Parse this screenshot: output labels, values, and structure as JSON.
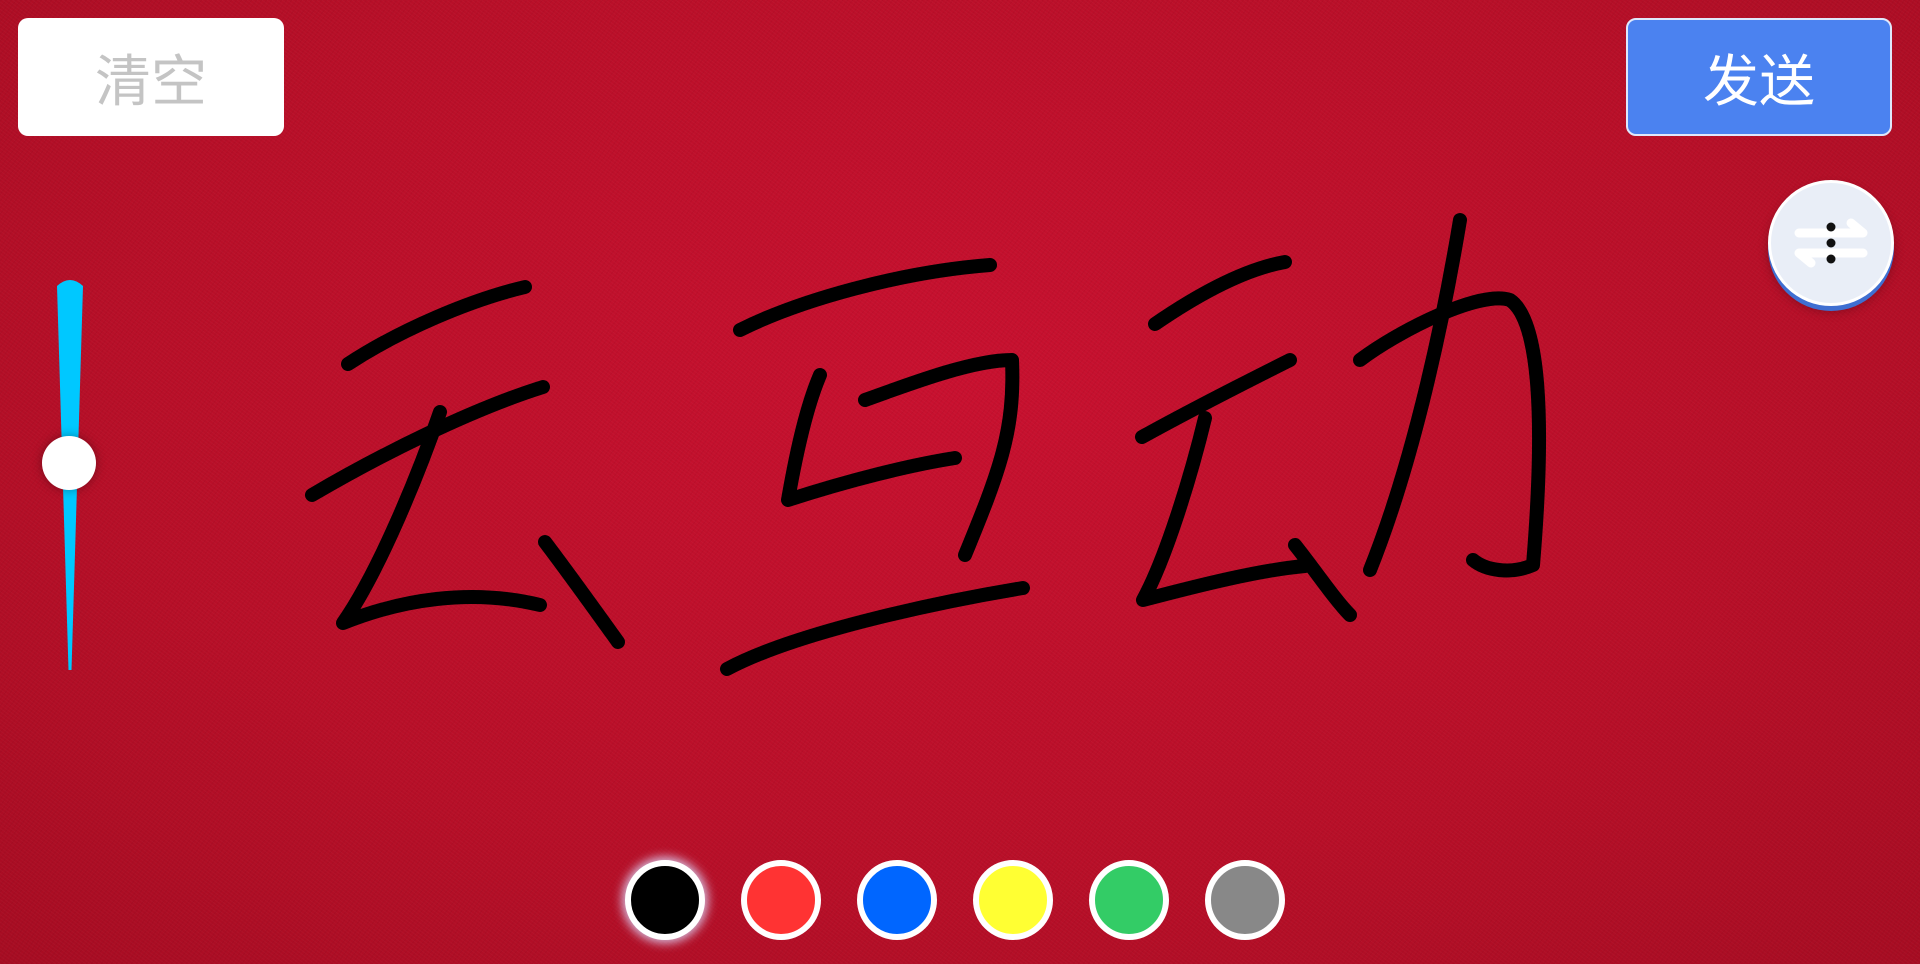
{
  "toolbar": {
    "clear_label": "清空",
    "send_label": "发送"
  },
  "menu_button": {
    "icon": "more-swap-icon"
  },
  "brush_size": {
    "level": 0.45,
    "track_color": "#00c8ff"
  },
  "drawing": {
    "ink_color": "#000000"
  },
  "palette": {
    "selected_index": 0,
    "colors": [
      "#000000",
      "#ff3333",
      "#0066ff",
      "#ffff33",
      "#33cc66",
      "#888888"
    ]
  },
  "colors": {
    "background": "#c8102f",
    "send_button": "#4b82f0",
    "clear_text": "#c4c4c4"
  }
}
